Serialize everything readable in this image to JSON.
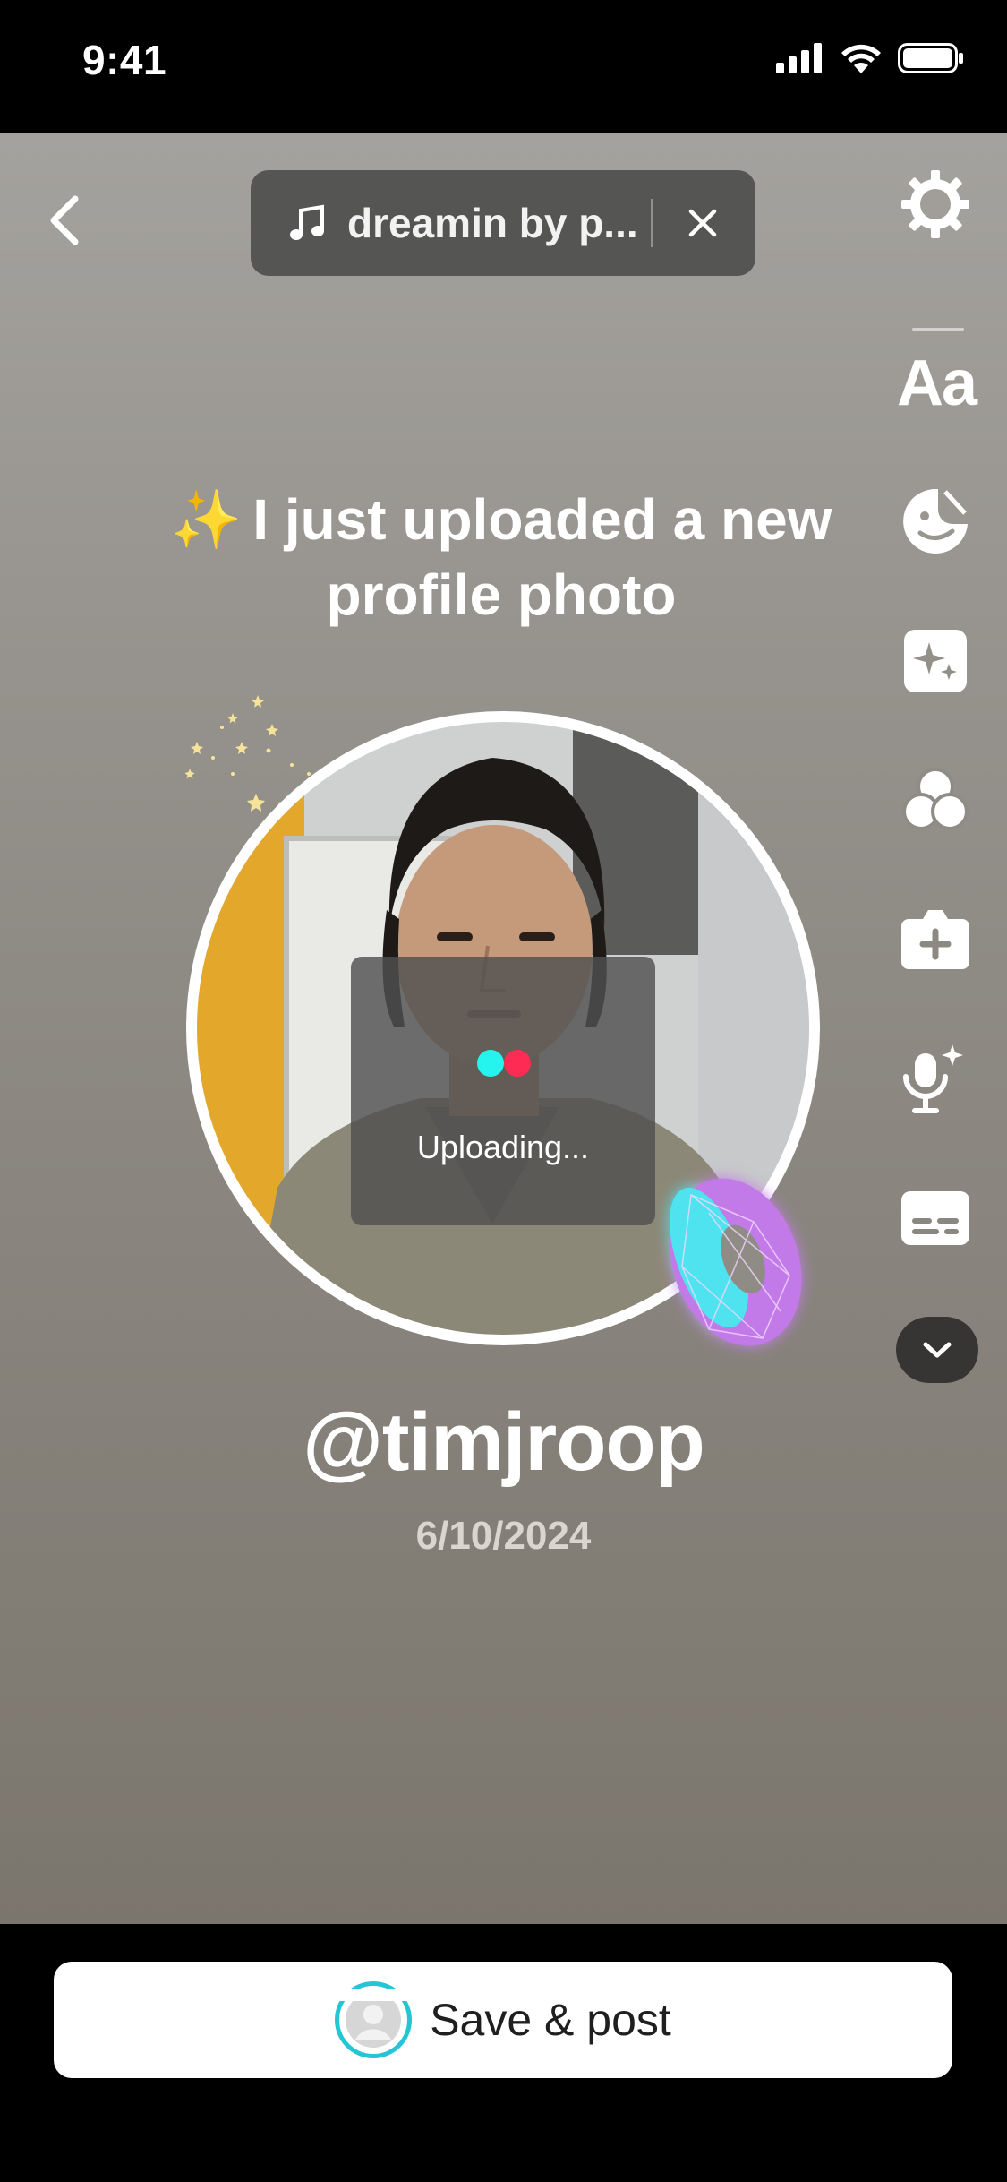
{
  "status_bar": {
    "time": "9:41"
  },
  "music": {
    "title": "dreamin by p..."
  },
  "side_tools": {
    "text_label": "Aa",
    "icons": [
      "settings-icon",
      "text-icon",
      "sticker-icon",
      "effects-icon",
      "filters-icon",
      "add-camera-icon",
      "voice-effects-icon",
      "captions-icon",
      "chevron-down-icon"
    ]
  },
  "post": {
    "headline_emoji": "✨",
    "headline": "I just uploaded a new profile photo",
    "handle": "@timjroop",
    "date": "6/10/2024"
  },
  "upload": {
    "status": "Uploading..."
  },
  "footer": {
    "save_label": "Save & post"
  },
  "colors": {
    "accent_cyan": "#25f4ee",
    "accent_red": "#fe2c55",
    "button_bg": "#ffffff"
  }
}
